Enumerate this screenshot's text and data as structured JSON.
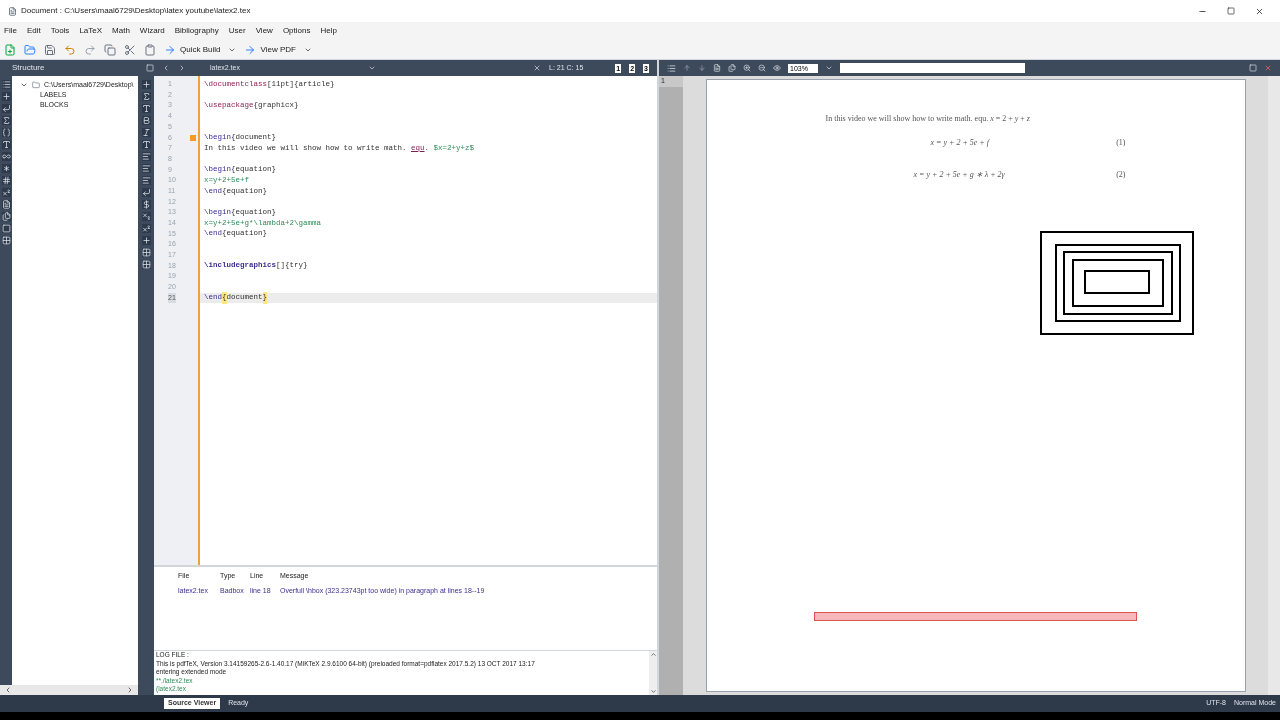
{
  "window": {
    "title": "Document : C:\\Users\\maal6729\\Desktop\\latex youtube\\latex2.tex"
  },
  "menu": [
    "File",
    "Edit",
    "Tools",
    "LaTeX",
    "Math",
    "Wizard",
    "Bibliography",
    "User",
    "View",
    "Options",
    "Help"
  ],
  "toolbar": {
    "quick_build": "Quick Build",
    "view_pdf": "View PDF"
  },
  "structure": {
    "title": "Structure",
    "tree": [
      {
        "label": "C:\\Users\\maal6729\\Desktop\\",
        "expanded": true,
        "children": [
          {
            "label": "LABELS"
          },
          {
            "label": "BLOCKS"
          }
        ]
      }
    ]
  },
  "editor": {
    "tab": "latex2.tex",
    "position": "L: 21 C: 15",
    "split_buttons": [
      "1",
      "2",
      "3"
    ],
    "lines": [
      {
        "number": "1",
        "selected": false,
        "fold": false,
        "segments": [
          {
            "kind": "cmd",
            "text": "\\documentclass"
          },
          {
            "kind": "plain",
            "text": "[11pt]{article}"
          }
        ]
      },
      {
        "number": "2",
        "selected": false,
        "fold": false
      },
      {
        "number": "3",
        "selected": false,
        "fold": false,
        "segments": [
          {
            "kind": "cmd",
            "text": "\\usepackage"
          },
          {
            "kind": "plain",
            "text": "{graphicx}"
          }
        ]
      },
      {
        "number": "4",
        "selected": false,
        "fold": false
      },
      {
        "number": "5",
        "selected": false,
        "fold": false
      },
      {
        "number": "6",
        "selected": false,
        "fold": true,
        "segments": [
          {
            "kind": "env",
            "text": "\\begin"
          },
          {
            "kind": "plain",
            "text": "{document}"
          }
        ]
      },
      {
        "number": "7",
        "selected": false,
        "fold": false,
        "segments": [
          {
            "kind": "plain",
            "text": "In this video we will show how to write math. "
          },
          {
            "kind": "spell",
            "text": "equ"
          },
          {
            "kind": "plain",
            "text": ". "
          },
          {
            "kind": "math",
            "text": "$x=2+y+z$"
          }
        ]
      },
      {
        "number": "8",
        "selected": false,
        "fold": false
      },
      {
        "number": "9",
        "selected": false,
        "fold": false,
        "segments": [
          {
            "kind": "env",
            "text": "\\begin"
          },
          {
            "kind": "plain",
            "text": "{equation}"
          }
        ]
      },
      {
        "number": "10",
        "selected": false,
        "fold": false,
        "segments": [
          {
            "kind": "math",
            "text": "x=y+2+5e+f"
          }
        ]
      },
      {
        "number": "11",
        "selected": false,
        "fold": false,
        "segments": [
          {
            "kind": "env",
            "text": "\\end"
          },
          {
            "kind": "plain",
            "text": "{equation}"
          }
        ]
      },
      {
        "number": "12",
        "selected": false,
        "fold": false
      },
      {
        "number": "13",
        "selected": false,
        "fold": false,
        "segments": [
          {
            "kind": "env",
            "text": "\\begin"
          },
          {
            "kind": "plain",
            "text": "{equation}"
          }
        ]
      },
      {
        "number": "14",
        "selected": false,
        "fold": false,
        "segments": [
          {
            "kind": "math",
            "text": "x=y+2+5e+g*\\lambda+2\\gamma"
          }
        ]
      },
      {
        "number": "15",
        "selected": false,
        "fold": false,
        "segments": [
          {
            "kind": "env",
            "text": "\\end"
          },
          {
            "kind": "plain",
            "text": "{equation}"
          }
        ]
      },
      {
        "number": "16",
        "selected": false,
        "fold": false
      },
      {
        "number": "17",
        "selected": false,
        "fold": false
      },
      {
        "number": "18",
        "selected": false,
        "fold": false,
        "segments": [
          {
            "kind": "bold",
            "text": "\\includegraphics"
          },
          {
            "kind": "plain",
            "text": "[]{try}"
          }
        ]
      },
      {
        "number": "19",
        "selected": false,
        "fold": false
      },
      {
        "number": "20",
        "selected": false,
        "fold": false
      },
      {
        "number": "21",
        "selected": true,
        "fold": false,
        "segments": [
          {
            "kind": "env",
            "text": "\\end"
          },
          {
            "kind": "brace",
            "text": "{"
          },
          {
            "kind": "plain",
            "text": "document"
          },
          {
            "kind": "brace",
            "text": "}"
          }
        ]
      }
    ]
  },
  "messages": {
    "columns": [
      "File",
      "Type",
      "Line",
      "Message"
    ],
    "rows": [
      [
        "latex2.tex",
        "Badbox",
        "line 18",
        "Overfull \\hbox (323.23743pt too wide) in paragraph at lines 18--19"
      ]
    ]
  },
  "log": {
    "lines": [
      {
        "kind": "plain",
        "text": "LOG FILE :"
      },
      {
        "kind": "plain",
        "text": "This is pdfTeX, Version 3.14159265-2.6-1.40.17 (MiKTeX 2.9.6100 64-bit) (preloaded format=pdflatex 2017.5.2) 13 OCT 2017 13:17"
      },
      {
        "kind": "plain",
        "text": "entering extended mode"
      },
      {
        "kind": "file",
        "text": "**./latex2.tex"
      },
      {
        "kind": "file",
        "text": "(latex2.tex"
      }
    ]
  },
  "viewer": {
    "zoom": "103%",
    "page_number": "1",
    "page": {
      "intro": "In this video we will show how to write math. equ. *x* = 2 + *y* + *z*",
      "equations": [
        {
          "formula": "x = y + 2 + 5e + f",
          "number": "(1)"
        },
        {
          "formula": "x = y + 2 + 5e + g ∗ λ + 2γ",
          "number": "(2)"
        }
      ]
    }
  },
  "status_bar": {
    "tabs": [
      {
        "label": "Source Viewer",
        "selected": true
      }
    ],
    "status": "Ready",
    "encoding": "UTF-8",
    "mode": "Normal Mode"
  }
}
